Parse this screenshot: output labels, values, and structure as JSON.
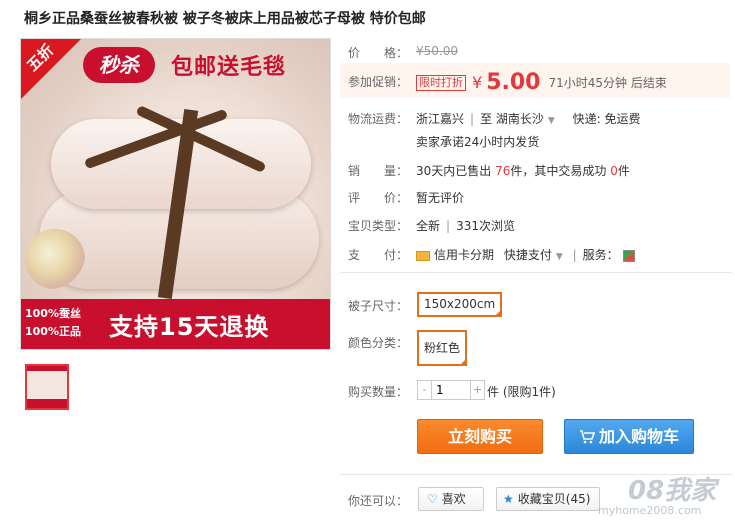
{
  "title": "桐乡正品桑蚕丝被春秋被 被子冬被床上用品被芯子母被 特价包邮",
  "image": {
    "badge_wuzhe": "五折",
    "badge_miaosha": "秒杀",
    "badge_baoyou": "包邮送毛毯",
    "banner_left_line1": "100%蚕丝",
    "banner_left_line2": "100%正品",
    "banner_main": "支持15天退换"
  },
  "price": {
    "label": "价　　格：",
    "original": "¥50.00"
  },
  "promo": {
    "label": "参加促销：",
    "tag": "限时打折",
    "currency": "¥",
    "value": "5.00",
    "countdown": "71小时45分钟 后结束"
  },
  "shipping": {
    "label": "物流运费：",
    "from": "浙江嘉兴",
    "to": "湖南长沙",
    "fee": "快递: 免运费",
    "promise": "卖家承诺24小时内发货"
  },
  "sales": {
    "label": "销　　量：",
    "prefix": "30天内已售出",
    "count": "76",
    "middle": "件，其中交易成功",
    "success": "0",
    "suffix": "件"
  },
  "review": {
    "label": "评　　价：",
    "value": "暂无评价"
  },
  "item_type": {
    "label": "宝贝类型：",
    "value": "全新",
    "views": "331次浏览"
  },
  "payment": {
    "label": "支　　付：",
    "credit": "信用卡分期",
    "quick": "快捷支付",
    "service_label": "服务："
  },
  "sku": {
    "size_label": "被子尺寸：",
    "size_value": "150x200cm",
    "color_label": "颜色分类：",
    "color_value": "粉红色"
  },
  "quantity": {
    "label": "购买数量：",
    "value": "1",
    "unit": "件 (限购1件)",
    "minus": "-",
    "plus": "+"
  },
  "buttons": {
    "buy": "立刻购买",
    "cart": "加入购物车"
  },
  "share": {
    "label": "你还可以：",
    "like": "喜欢",
    "fav": "收藏宝贝(45)"
  },
  "watermark": {
    "text": "08我家",
    "url": "myhome2008.com"
  },
  "colors": {
    "accent_red": "#e4393c",
    "buy_orange": "#f06e10",
    "cart_blue": "#2b87d9",
    "sku_border": "#e07020"
  }
}
